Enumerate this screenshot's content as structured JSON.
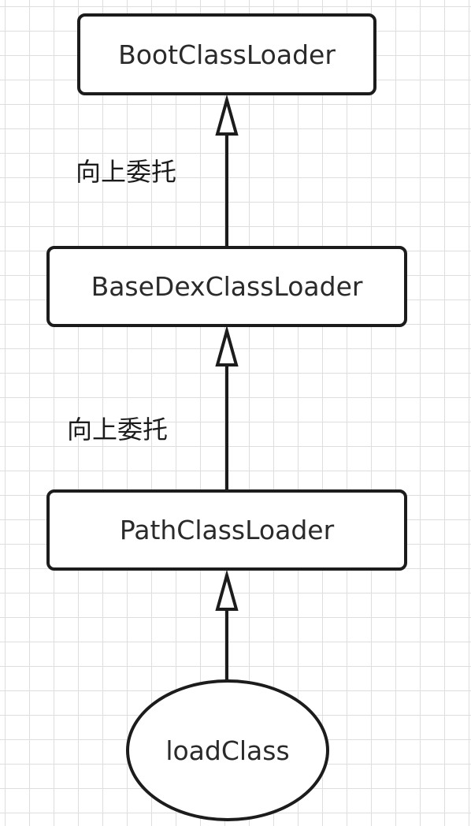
{
  "diagram": {
    "nodes": {
      "boot": "BootClassLoader",
      "base": "BaseDexClassLoader",
      "path": "PathClassLoader",
      "load": "loadClass"
    },
    "edge_labels": {
      "base_to_boot": "向上委托",
      "path_to_base": "向上委托"
    },
    "colors": {
      "stroke": "#1c1c1c",
      "fill": "#ffffff",
      "grid": "#dedede"
    }
  }
}
